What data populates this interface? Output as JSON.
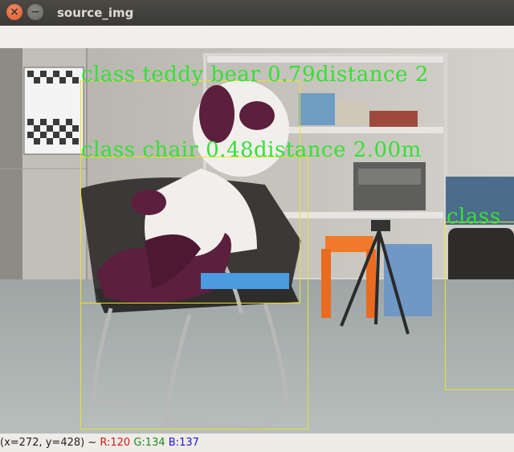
{
  "window": {
    "title": "source_img"
  },
  "detections": [
    {
      "text": "class teddy bear 0.79distance 2"
    },
    {
      "text": "class chair 0.48distance 2.00m"
    },
    {
      "text": "class"
    }
  ],
  "status": {
    "coords": "(x=272, y=428) ~ ",
    "r_label": "R:120",
    "g_label": "G:134",
    "b_label": "B:137"
  },
  "colors": {
    "box": "#e8e22a",
    "label": "#35e035",
    "titlebar": "#3f3e3a",
    "close_button": "#e95c2c"
  }
}
